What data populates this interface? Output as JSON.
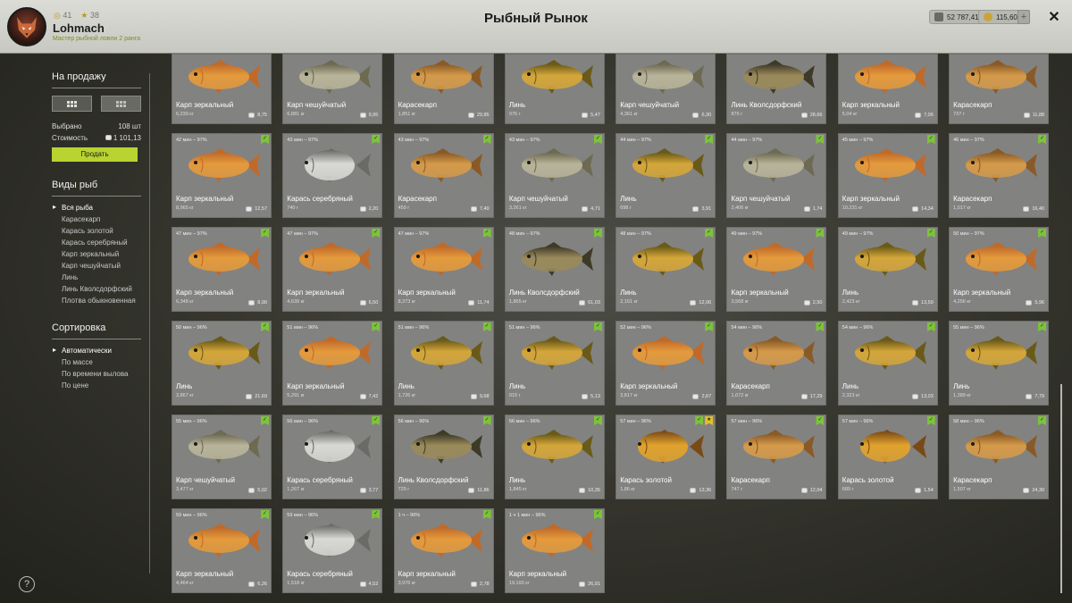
{
  "header": {
    "title": "Рыбный Рынок",
    "stat_level": "41",
    "stat_stars": "38",
    "username": "Lohmach",
    "rank": "Мастер рыбной ловли 2 ранга",
    "silver": "52 787,41",
    "gold": "115,60",
    "plus_label": "+",
    "close_label": "✕"
  },
  "sidebar": {
    "for_sale_title": "На продажу",
    "selected_label": "Выбрано",
    "selected_value": "108 шт",
    "cost_label": "Стоимость",
    "cost_value": "1 101,13",
    "sell_button": "Продать",
    "species_title": "Виды рыб",
    "species": [
      "Вся рыба",
      "Карасекарп",
      "Карась золотой",
      "Карась серебряный",
      "Карп зеркальный",
      "Карп чешуйчатый",
      "Линь",
      "Линь Кволсдорфский",
      "Плотва обыкновенная"
    ],
    "species_active": 0,
    "sort_title": "Сортировка",
    "sort": [
      "Автоматически",
      "По массе",
      "По времени вылова",
      "По цене"
    ],
    "sort_active": 0
  },
  "help_label": "?",
  "colors": {
    "accent": "#b9d430",
    "badge_green": "#7cc33a",
    "badge_gold": "#e4c02a",
    "card_bg": "#828280"
  },
  "fish_colors": {
    "mirror": [
      "#e49a3c",
      "#c06a2a"
    ],
    "common": [
      "#b8b49a",
      "#6e6a52"
    ],
    "karasekarp": [
      "#d49a4a",
      "#8a5a26"
    ],
    "tench": [
      "#d4a63a",
      "#6a5a18"
    ],
    "tench_kw": [
      "#9a8a5a",
      "#3e3a28"
    ],
    "silver": [
      "#d8d8d4",
      "#6a6a66"
    ],
    "gold": [
      "#e0a22e",
      "#7a4a16"
    ]
  },
  "fish": [
    {
      "name": "Карп зеркальный",
      "weight": "6,239 кг",
      "price": "8,75",
      "time": "",
      "badges": 0,
      "kind": "mirror"
    },
    {
      "name": "Карп чешуйчатый",
      "weight": "6,881 кг",
      "price": "9,95",
      "time": "",
      "badges": 0,
      "kind": "common"
    },
    {
      "name": "Карасекарп",
      "weight": "1,851 кг",
      "price": "29,85",
      "time": "",
      "badges": 0,
      "kind": "karasekarp"
    },
    {
      "name": "Линь",
      "weight": "976 г",
      "price": "5,47",
      "time": "",
      "badges": 0,
      "kind": "tench"
    },
    {
      "name": "Карп чешуйчатый",
      "weight": "4,361 кг",
      "price": "6,30",
      "time": "",
      "badges": 0,
      "kind": "common"
    },
    {
      "name": "Линь Кволсдорфский",
      "weight": "876 г",
      "price": "28,66",
      "time": "",
      "badges": 0,
      "kind": "tench_kw"
    },
    {
      "name": "Карп зеркальный",
      "weight": "5,04 кг",
      "price": "7,06",
      "time": "",
      "badges": 0,
      "kind": "mirror"
    },
    {
      "name": "Карасекарп",
      "weight": "737 г",
      "price": "11,88",
      "time": "",
      "badges": 0,
      "kind": "karasekarp"
    },
    {
      "name": "Карп зеркальный",
      "weight": "8,965 кг",
      "price": "12,57",
      "time": "42 мин – 97%",
      "badges": 1,
      "kind": "mirror"
    },
    {
      "name": "Карась серебряный",
      "weight": "740 г",
      "price": "2,20",
      "time": "43 мин – 97%",
      "badges": 1,
      "kind": "silver"
    },
    {
      "name": "Карасекарп",
      "weight": "459 г",
      "price": "7,40",
      "time": "43 мин – 97%",
      "badges": 1,
      "kind": "karasekarp"
    },
    {
      "name": "Карп чешуйчатый",
      "weight": "3,261 кг",
      "price": "4,71",
      "time": "43 мин – 97%",
      "badges": 1,
      "kind": "common"
    },
    {
      "name": "Линь",
      "weight": "698 г",
      "price": "3,91",
      "time": "44 мин – 97%",
      "badges": 1,
      "kind": "tench"
    },
    {
      "name": "Карп чешуйчатый",
      "weight": "2,406 кг",
      "price": "1,74",
      "time": "44 мин – 97%",
      "badges": 1,
      "kind": "common"
    },
    {
      "name": "Карп зеркальный",
      "weight": "10,231 кг",
      "price": "14,34",
      "time": "45 мин – 97%",
      "badges": 1,
      "kind": "mirror"
    },
    {
      "name": "Карасекарп",
      "weight": "1,017 кг",
      "price": "16,40",
      "time": "46 мин – 97%",
      "badges": 1,
      "kind": "karasekarp"
    },
    {
      "name": "Карп зеркальный",
      "weight": "6,348 кг",
      "price": "8,90",
      "time": "47 мин – 97%",
      "badges": 1,
      "kind": "mirror"
    },
    {
      "name": "Карп зеркальный",
      "weight": "4,639 кг",
      "price": "6,50",
      "time": "47 мин – 97%",
      "badges": 1,
      "kind": "mirror"
    },
    {
      "name": "Карп зеркальный",
      "weight": "8,373 кг",
      "price": "11,74",
      "time": "47 мин – 97%",
      "badges": 1,
      "kind": "mirror"
    },
    {
      "name": "Линь Кволсдорфский",
      "weight": "1,865 кг",
      "price": "61,03",
      "time": "48 мин – 97%",
      "badges": 1,
      "kind": "tench_kw"
    },
    {
      "name": "Линь",
      "weight": "2,151 кг",
      "price": "12,06",
      "time": "48 мин – 97%",
      "badges": 1,
      "kind": "tench"
    },
    {
      "name": "Карп зеркальный",
      "weight": "3,568 кг",
      "price": "2,50",
      "time": "49 мин – 97%",
      "badges": 1,
      "kind": "mirror"
    },
    {
      "name": "Линь",
      "weight": "2,423 кг",
      "price": "13,59",
      "time": "49 мин – 97%",
      "badges": 1,
      "kind": "tench"
    },
    {
      "name": "Карп зеркальный",
      "weight": "4,256 кг",
      "price": "5,96",
      "time": "50 мин – 97%",
      "badges": 1,
      "kind": "mirror"
    },
    {
      "name": "Линь",
      "weight": "3,867 кг",
      "price": "21,69",
      "time": "50 мин – 96%",
      "badges": 1,
      "kind": "tench"
    },
    {
      "name": "Карп зеркальный",
      "weight": "5,291 кг",
      "price": "7,42",
      "time": "51 мин – 96%",
      "badges": 1,
      "kind": "mirror"
    },
    {
      "name": "Линь",
      "weight": "1,726 кг",
      "price": "9,68",
      "time": "51 мин – 96%",
      "badges": 1,
      "kind": "tench"
    },
    {
      "name": "Линь",
      "weight": "915 г",
      "price": "5,13",
      "time": "51 мин – 96%",
      "badges": 1,
      "kind": "tench"
    },
    {
      "name": "Карп зеркальный",
      "weight": "3,817 кг",
      "price": "2,67",
      "time": "52 мин – 96%",
      "badges": 1,
      "kind": "mirror"
    },
    {
      "name": "Карасекарп",
      "weight": "1,072 кг",
      "price": "17,29",
      "time": "54 мин – 96%",
      "badges": 1,
      "kind": "karasekarp"
    },
    {
      "name": "Линь",
      "weight": "2,323 кг",
      "price": "13,03",
      "time": "54 мин – 96%",
      "badges": 1,
      "kind": "tench"
    },
    {
      "name": "Линь",
      "weight": "1,389 кг",
      "price": "7,79",
      "time": "55 мин – 96%",
      "badges": 1,
      "kind": "tench"
    },
    {
      "name": "Карп чешуйчатый",
      "weight": "3,477 кг",
      "price": "5,02",
      "time": "55 мин – 96%",
      "badges": 1,
      "kind": "common"
    },
    {
      "name": "Карась серебряный",
      "weight": "1,267 кг",
      "price": "3,77",
      "time": "56 мин – 96%",
      "badges": 1,
      "kind": "silver"
    },
    {
      "name": "Линь Кволсдорфский",
      "weight": "725 г",
      "price": "11,86",
      "time": "56 мин – 96%",
      "badges": 1,
      "kind": "tench_kw"
    },
    {
      "name": "Линь",
      "weight": "1,845 кг",
      "price": "10,35",
      "time": "56 мин – 96%",
      "badges": 1,
      "kind": "tench"
    },
    {
      "name": "Карась золотой",
      "weight": "1,86 кг",
      "price": "13,36",
      "time": "57 мин – 96%",
      "badges": 2,
      "kind": "gold"
    },
    {
      "name": "Карасекарп",
      "weight": "747 г",
      "price": "12,04",
      "time": "57 мин – 96%",
      "badges": 1,
      "kind": "karasekarp"
    },
    {
      "name": "Карась золотой",
      "weight": "689 г",
      "price": "1,54",
      "time": "57 мин – 96%",
      "badges": 1,
      "kind": "gold"
    },
    {
      "name": "Карасекарп",
      "weight": "1,507 кг",
      "price": "24,30",
      "time": "58 мин – 96%",
      "badges": 1,
      "kind": "karasekarp"
    },
    {
      "name": "Карп зеркальный",
      "weight": "4,464 кг",
      "price": "6,26",
      "time": "59 мин – 96%",
      "badges": 1,
      "kind": "mirror"
    },
    {
      "name": "Карась серебряный",
      "weight": "1,518 кг",
      "price": "4,52",
      "time": "59 мин – 96%",
      "badges": 1,
      "kind": "silver"
    },
    {
      "name": "Карп зеркальный",
      "weight": "3,976 кг",
      "price": "2,78",
      "time": "1 ч – 96%",
      "badges": 1,
      "kind": "mirror"
    },
    {
      "name": "Карп зеркальный",
      "weight": "19,193 кг",
      "price": "26,91",
      "time": "1 ч 1 мин – 96%",
      "badges": 1,
      "kind": "mirror"
    }
  ]
}
